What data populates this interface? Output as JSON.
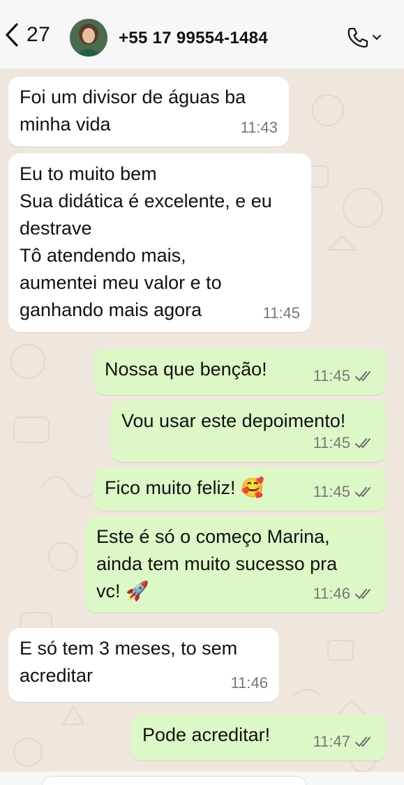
{
  "header": {
    "unread_count": "27",
    "contact_name": "+55 17 99554-1484"
  },
  "messages": [
    {
      "direction": "in",
      "text": "Foi um divisor de águas ba\nminha vida",
      "time": "11:43"
    },
    {
      "direction": "in",
      "text": "Eu to muito bem\nSua didática é excelente, e eu\ndestrave\nTô atendendo mais,\naumentei meu valor e to\nganhando mais agora",
      "time": "11:45"
    },
    {
      "direction": "out",
      "text": "Nossa que benção!",
      "time": "11:45"
    },
    {
      "direction": "out",
      "text": "Vou usar este depoimento!",
      "time": "11:45"
    },
    {
      "direction": "out",
      "text": "Fico muito feliz! 🥰",
      "time": "11:45"
    },
    {
      "direction": "out",
      "text": "Este é só o começo Marina,\nainda tem muito sucesso pra\nvc! 🚀",
      "time": "11:46"
    },
    {
      "direction": "in",
      "text": "E só tem 3 meses, to sem\nacreditar",
      "time": "11:46"
    },
    {
      "direction": "out",
      "text": "Pode acreditar!",
      "time": "11:47"
    }
  ],
  "icons": {
    "back": "chevron-left-icon",
    "call": "phone-icon",
    "call_menu": "chevron-down-icon",
    "read_receipt": "double-check-icon"
  },
  "colors": {
    "incoming_bubble": "#ffffff",
    "outgoing_bubble": "#dcf8c6",
    "chat_background": "#efe7dd",
    "read_ticks": "#6b6b6b"
  }
}
